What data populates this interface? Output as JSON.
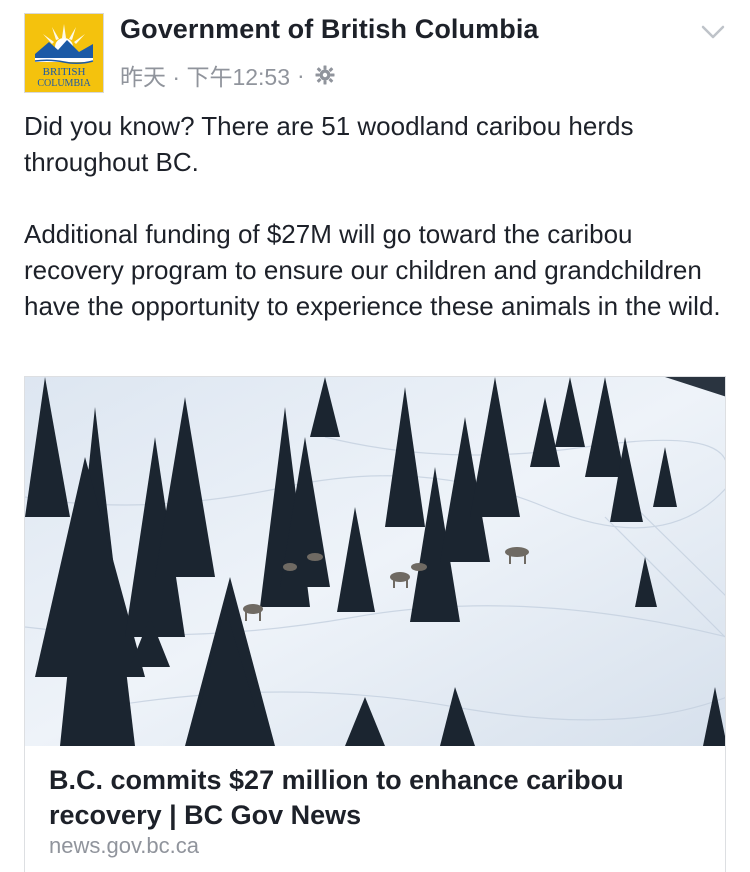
{
  "post": {
    "page_name": "Government of British Columbia",
    "timestamp": "昨天 · 下午12:53",
    "separator": "·",
    "privacy_icon": "gear-icon",
    "menu_icon": "chevron-down-icon",
    "avatar": {
      "logo_line1": "BRITISH",
      "logo_line2": "COLUMBIA",
      "colors": {
        "background": "#f4c20d",
        "sky": "#1c5aa6",
        "text": "#1c5aa6"
      }
    },
    "message_paragraphs": [
      "Did you know? There are 51 woodland caribou herds throughout BC.",
      "Additional funding of $27M will go toward the caribou recovery program to ensure our children and grandchildren have the opportunity to experience these animals in the wild."
    ]
  },
  "link_card": {
    "image_description_icon": "photo-caribou-herd",
    "title": "B.C. commits $27 million to enhance caribou recovery | BC Gov News",
    "domain": "news.gov.bc.ca"
  },
  "colors": {
    "text_primary": "#1d2129",
    "text_secondary": "#90949c",
    "border": "#dddfe2"
  }
}
